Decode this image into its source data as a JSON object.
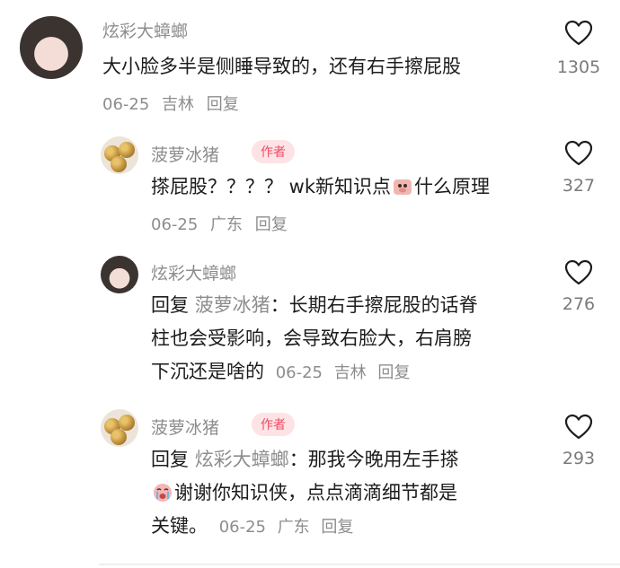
{
  "comments": [
    {
      "username": "炫彩大蟑螂",
      "text": "大小脸多半是侧睡导致的，还有右手擦屁股",
      "date": "06-25",
      "location": "吉林",
      "reply_label": "回复",
      "likes": "1305"
    },
    {
      "username": "菠萝冰猪",
      "badge": "作者",
      "text_before_emoji": "搽屁股？？？？ wk新知识点",
      "text_after_emoji": "什么原理",
      "date": "06-25",
      "location": "广东",
      "reply_label": "回复",
      "likes": "327"
    },
    {
      "username": "炫彩大蟑螂",
      "reply_prefix": "回复",
      "mention": "菠萝冰猪",
      "text_line1": "：长期右手擦屁股的话脊",
      "text_line2": "柱也会受影响，会导致右脸大，右肩膀",
      "text_line3": "下沉还是啥的",
      "date": "06-25",
      "location": "吉林",
      "reply_label": "回复",
      "likes": "276"
    },
    {
      "username": "菠萝冰猪",
      "badge": "作者",
      "reply_prefix": "回复",
      "mention": "炫彩大蟑螂",
      "text_line1": "：那我今晚用左手搽",
      "text_line2": "谢谢你知识侠，点点滴滴细节都是",
      "text_line3": "关键。",
      "date": "06-25",
      "location": "广东",
      "reply_label": "回复",
      "likes": "293"
    }
  ],
  "icons": {
    "heart": "heart-outline-icon",
    "emoji_pig": "pig-face-emoji-icon",
    "emoji_cry": "crying-face-emoji-icon"
  },
  "colors": {
    "name": "#8d8d8d",
    "text": "#1c1c1c",
    "badge_bg": "#fde3e6",
    "badge_text": "#f04b63"
  }
}
